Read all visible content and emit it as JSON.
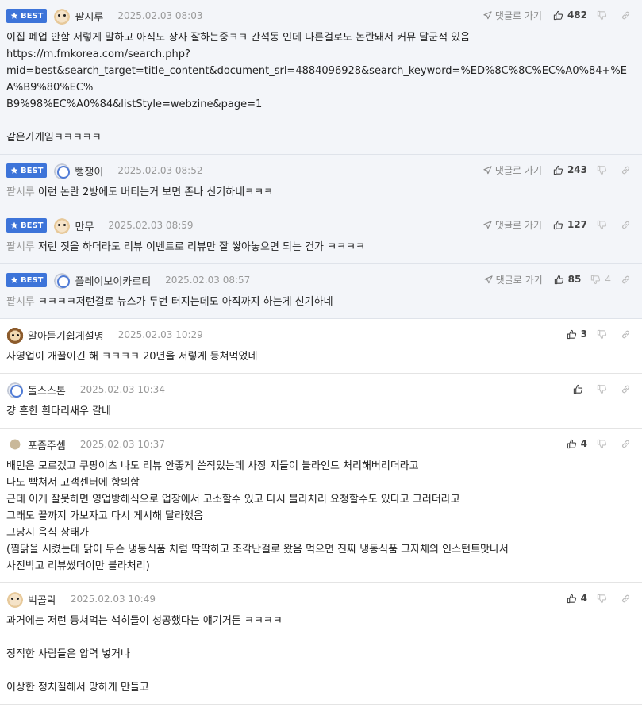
{
  "labels": {
    "best": "BEST",
    "go_post": "댓글로 가기"
  },
  "comments": [
    {
      "best": true,
      "avatar": "dog",
      "nick": "팥시루",
      "date": "2025.02.03 08:03",
      "up": "482",
      "down": "",
      "reply_to": "",
      "lines": [
        "이집 폐업 안함 저렇게 말하고 아직도 장사 잘하는중ㅋㅋ 간석동 인데 다른걸로도 논란돼서 커뮤 달군적 있음",
        "https://m.fmkorea.com/search.php?",
        "mid=best&search_target=title_content&document_srl=4884096928&search_keyword=%ED%8C%8C%EC%A0%84+%EA%B9%80%EC%",
        "B9%98%EC%A0%84&listStyle=webzine&page=1",
        "",
        "같은가게임ㅋㅋㅋㅋㅋ"
      ]
    },
    {
      "best": true,
      "avatar": "bear",
      "nick": "뻥쟁이",
      "date": "2025.02.03 08:52",
      "up": "243",
      "down": "",
      "reply_to": "팥시루",
      "lines": [
        "이런 논란 2방에도 버티는거 보면 존나 신기하네ㅋㅋㅋ"
      ]
    },
    {
      "best": true,
      "avatar": "dog",
      "nick": "만무",
      "date": "2025.02.03 08:59",
      "up": "127",
      "down": "",
      "reply_to": "팥시루",
      "lines": [
        "저런 짓을 하더라도 리뷰 이벤트로 리뷰만 잘 쌓아놓으면 되는 건가 ㅋㅋㅋㅋ"
      ]
    },
    {
      "best": true,
      "avatar": "bear",
      "nick": "플레이보이카르티",
      "date": "2025.02.03 08:57",
      "up": "85",
      "down": "4",
      "reply_to": "팥시루",
      "lines": [
        "ㅋㅋㅋㅋ저런걸로 뉴스가 두번 터지는데도 아직까지 하는게 신기하네"
      ]
    },
    {
      "best": false,
      "avatar": "brown",
      "nick": "알아듣기쉽게설명",
      "date": "2025.02.03 10:29",
      "up": "3",
      "down": "",
      "reply_to": "",
      "lines": [
        "자영업이 개꿀이긴 해 ㅋㅋㅋㅋ 20년을 저렇게 등쳐먹었네"
      ]
    },
    {
      "best": false,
      "avatar": "bear",
      "nick": "돌스스톤",
      "date": "2025.02.03 10:34",
      "up": "",
      "down": "",
      "reply_to": "",
      "lines": [
        "걍 흔한 흰다리새우 갈네"
      ]
    },
    {
      "best": false,
      "avatar": "plain",
      "nick": "포즘주셈",
      "date": "2025.02.03 10:37",
      "up": "4",
      "down": "",
      "reply_to": "",
      "lines": [
        "배민은 모르겠고 쿠팡이츠 나도 리뷰 안좋게 쓴적있는데 사장 지들이 블라인드 처리해버리더라고",
        "나도 빡쳐서 고객센터에 항의함",
        "근데 이게 잘못하면 영업방해식으로 업장에서 고소할수 있고 다시 블라처리 요청할수도 있다고 그러더라고",
        "그래도 끝까지 가보자고 다시 게시해 달라했음",
        "그당시 음식 상태가",
        "(찜닭을 시켰는데 닭이 무슨 냉동식품 처럼 딱딱하고 조각난걸로 왔음 먹으면 진짜 냉동식품 그자체의 인스턴트맛나서",
        "사진박고 리뷰썼더이만 블라처리)"
      ]
    },
    {
      "best": false,
      "avatar": "dog",
      "nick": "빅골락",
      "date": "2025.02.03 10:49",
      "up": "4",
      "down": "",
      "reply_to": "",
      "lines": [
        "과거에는 저런 등쳐먹는 색히들이 성공했다는 얘기거든 ㅋㅋㅋㅋ",
        "",
        "정직한 사람들은 압력 넣거나",
        "",
        "이상한 정치질해서 망하게 만들고"
      ]
    }
  ]
}
